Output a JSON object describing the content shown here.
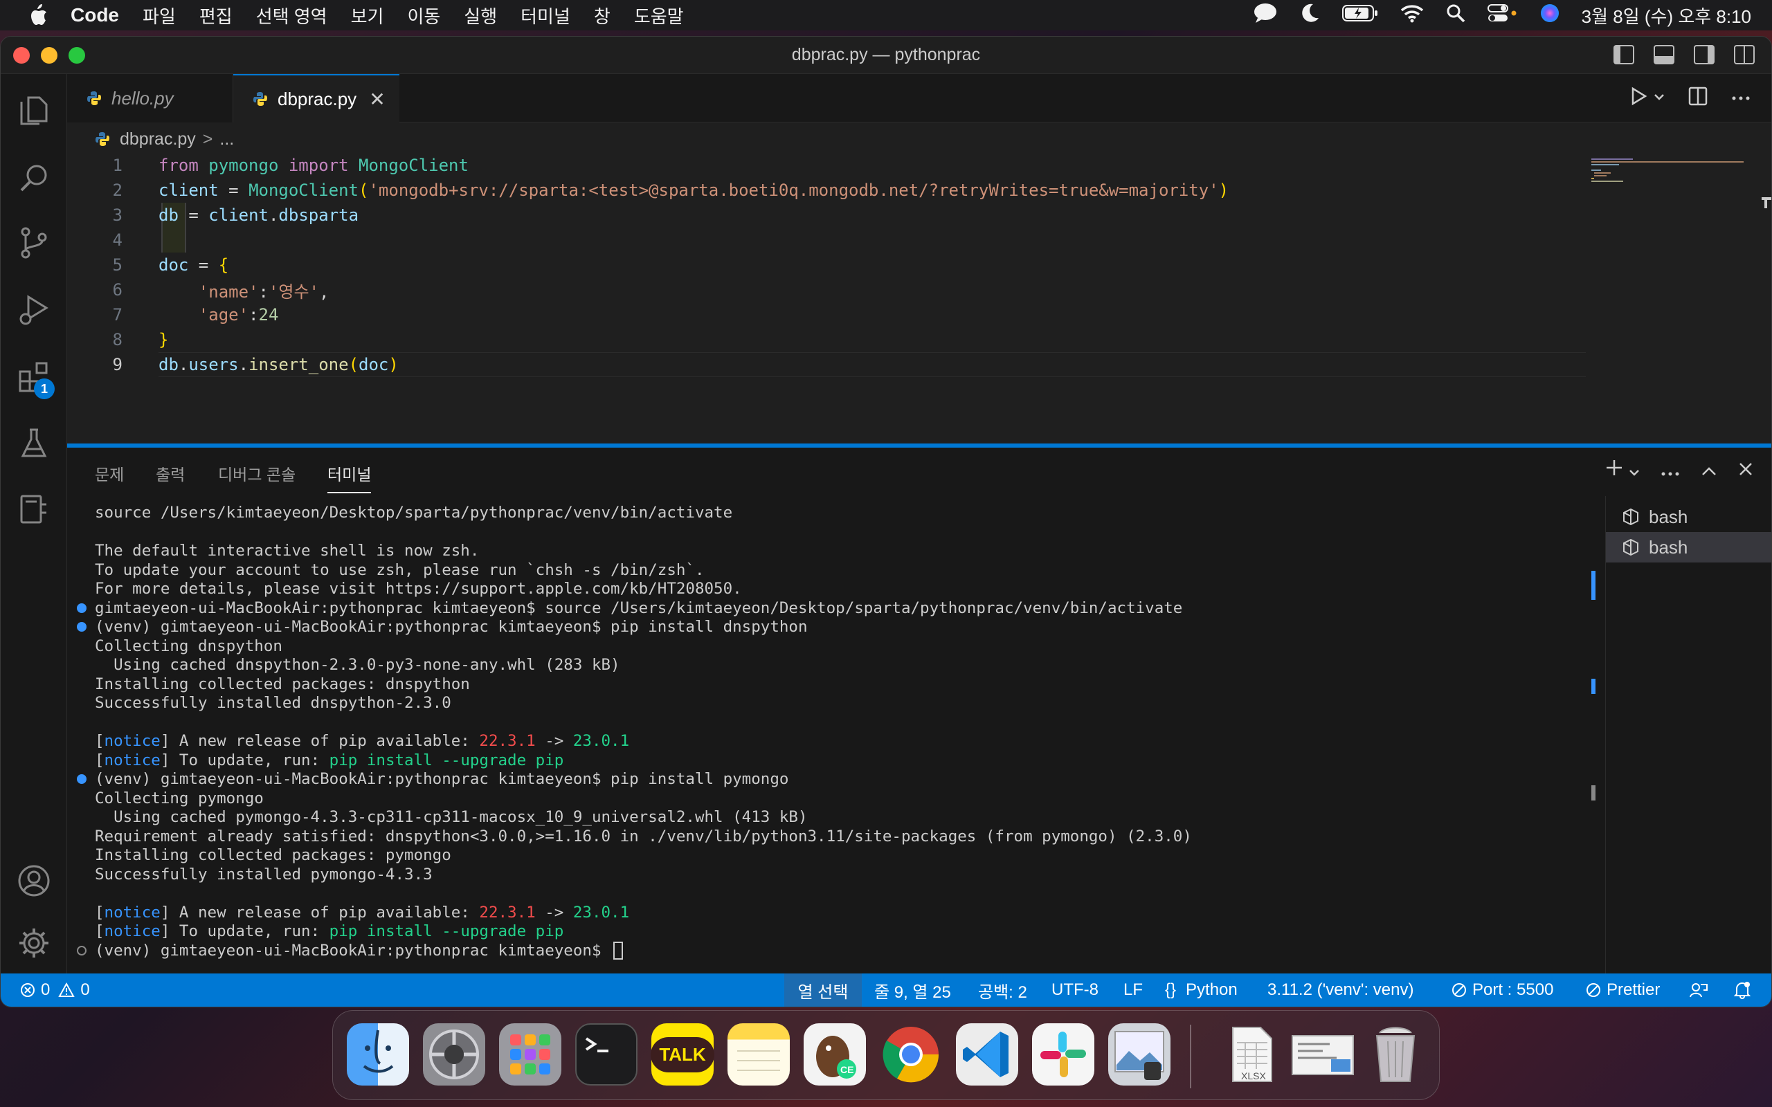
{
  "menubar": {
    "app_name": "Code",
    "items": [
      "파일",
      "편집",
      "선택 영역",
      "보기",
      "이동",
      "실행",
      "터미널",
      "창",
      "도움말"
    ],
    "clock": "3월 8일 (수) 오후 8:10",
    "status_icons": [
      "messages-icon",
      "moon-icon",
      "battery-icon",
      "wifi-icon",
      "spotlight-search-icon",
      "control-center-icon",
      "siri-icon"
    ]
  },
  "window": {
    "title": "dbprac.py — pythonprac"
  },
  "tabs": [
    {
      "label": "hello.py",
      "active": false
    },
    {
      "label": "dbprac.py",
      "active": true,
      "close": "✕"
    }
  ],
  "breadcrumb": {
    "file": "dbprac.py",
    "separator": ">",
    "more": "..."
  },
  "editor": {
    "lines": [
      {
        "n": "1",
        "tokens": [
          [
            "kw",
            "from "
          ],
          [
            "mod",
            "pymongo "
          ],
          [
            "kw",
            "import "
          ],
          [
            "mod",
            "MongoClient"
          ]
        ]
      },
      {
        "n": "2",
        "tokens": [
          [
            "var",
            "client "
          ],
          [
            "op",
            "= "
          ],
          [
            "mod",
            "MongoClient"
          ],
          [
            "brace1",
            "("
          ],
          [
            "str",
            "'mongodb+srv://sparta:<test>@sparta.boeti0q.mongodb.net/?retryWrites=true&w=majority'"
          ],
          [
            "brace1",
            ")"
          ]
        ]
      },
      {
        "n": "3",
        "tokens": [
          [
            "var",
            "db "
          ],
          [
            "op",
            "= "
          ],
          [
            "var",
            "client"
          ],
          [
            "op",
            "."
          ],
          [
            "var",
            "dbsparta"
          ]
        ]
      },
      {
        "n": "4",
        "tokens": []
      },
      {
        "n": "5",
        "tokens": [
          [
            "var",
            "doc "
          ],
          [
            "op",
            "= "
          ],
          [
            "brace1",
            "{"
          ]
        ]
      },
      {
        "n": "6",
        "tokens": [
          [
            "op",
            "    "
          ],
          [
            "str",
            "'name'"
          ],
          [
            "op",
            ":"
          ],
          [
            "str",
            "'영수'"
          ],
          [
            "op",
            ","
          ]
        ]
      },
      {
        "n": "7",
        "tokens": [
          [
            "op",
            "    "
          ],
          [
            "str",
            "'age'"
          ],
          [
            "op",
            ":"
          ],
          [
            "num",
            "24"
          ]
        ]
      },
      {
        "n": "8",
        "tokens": [
          [
            "brace1",
            "}"
          ]
        ]
      },
      {
        "n": "9",
        "tokens": [
          [
            "var",
            "db"
          ],
          [
            "op",
            "."
          ],
          [
            "var",
            "users"
          ],
          [
            "op",
            "."
          ],
          [
            "fn",
            "insert_one"
          ],
          [
            "brace1",
            "("
          ],
          [
            "var",
            "doc"
          ],
          [
            "brace1",
            ")"
          ]
        ]
      }
    ],
    "current_line": "9"
  },
  "panel": {
    "tabs": [
      "문제",
      "출력",
      "디버그 콘솔",
      "터미널"
    ],
    "active_tab": "터미널",
    "terminals": [
      "bash",
      "bash"
    ]
  },
  "terminal": {
    "lines": [
      {
        "dot": "",
        "segs": [
          [
            "",
            "source /Users/kimtaeyeon/Desktop/sparta/pythonprac/venv/bin/activate"
          ]
        ]
      },
      {
        "dot": "",
        "segs": [
          [
            "",
            ""
          ]
        ]
      },
      {
        "dot": "",
        "segs": [
          [
            "",
            "The default interactive shell is now zsh."
          ]
        ]
      },
      {
        "dot": "",
        "segs": [
          [
            "",
            "To update your account to use zsh, please run `chsh -s /bin/zsh`."
          ]
        ]
      },
      {
        "dot": "",
        "segs": [
          [
            "",
            "For more details, please visit https://support.apple.com/kb/HT208050."
          ]
        ]
      },
      {
        "dot": "filled",
        "segs": [
          [
            "",
            "gimtaeyeon-ui-MacBookAir:pythonprac kimtaeyeon$ source /Users/kimtaeyeon/Desktop/sparta/pythonprac/venv/bin/activate"
          ]
        ]
      },
      {
        "dot": "filled",
        "segs": [
          [
            "",
            "(venv) gimtaeyeon-ui-MacBookAir:pythonprac kimtaeyeon$ pip install dnspython"
          ]
        ]
      },
      {
        "dot": "",
        "segs": [
          [
            "",
            "Collecting dnspython"
          ]
        ]
      },
      {
        "dot": "",
        "segs": [
          [
            "",
            "  Using cached dnspython-2.3.0-py3-none-any.whl (283 kB)"
          ]
        ]
      },
      {
        "dot": "",
        "segs": [
          [
            "",
            "Installing collected packages: dnspython"
          ]
        ]
      },
      {
        "dot": "",
        "segs": [
          [
            "",
            "Successfully installed dnspython-2.3.0"
          ]
        ]
      },
      {
        "dot": "",
        "segs": [
          [
            "",
            ""
          ]
        ]
      },
      {
        "dot": "",
        "segs": [
          [
            "",
            "["
          ],
          [
            "notice",
            "notice"
          ],
          [
            "",
            "] A new release of pip available: "
          ],
          [
            "red",
            "22.3.1"
          ],
          [
            "",
            " -> "
          ],
          [
            "green",
            "23.0.1"
          ]
        ]
      },
      {
        "dot": "",
        "segs": [
          [
            "",
            "["
          ],
          [
            "notice",
            "notice"
          ],
          [
            "",
            "] To update, run: "
          ],
          [
            "green",
            "pip install --upgrade pip"
          ]
        ]
      },
      {
        "dot": "filled",
        "segs": [
          [
            "",
            "(venv) gimtaeyeon-ui-MacBookAir:pythonprac kimtaeyeon$ pip install pymongo"
          ]
        ]
      },
      {
        "dot": "",
        "segs": [
          [
            "",
            "Collecting pymongo"
          ]
        ]
      },
      {
        "dot": "",
        "segs": [
          [
            "",
            "  Using cached pymongo-4.3.3-cp311-cp311-macosx_10_9_universal2.whl (413 kB)"
          ]
        ]
      },
      {
        "dot": "",
        "segs": [
          [
            "",
            "Requirement already satisfied: dnspython<3.0.0,>=1.16.0 in ./venv/lib/python3.11/site-packages (from pymongo) (2.3.0)"
          ]
        ]
      },
      {
        "dot": "",
        "segs": [
          [
            "",
            "Installing collected packages: pymongo"
          ]
        ]
      },
      {
        "dot": "",
        "segs": [
          [
            "",
            "Successfully installed pymongo-4.3.3"
          ]
        ]
      },
      {
        "dot": "",
        "segs": [
          [
            "",
            ""
          ]
        ]
      },
      {
        "dot": "",
        "segs": [
          [
            "",
            "["
          ],
          [
            "notice",
            "notice"
          ],
          [
            "",
            "] A new release of pip available: "
          ],
          [
            "red",
            "22.3.1"
          ],
          [
            "",
            " -> "
          ],
          [
            "green",
            "23.0.1"
          ]
        ]
      },
      {
        "dot": "",
        "segs": [
          [
            "",
            "["
          ],
          [
            "notice",
            "notice"
          ],
          [
            "",
            "] To update, run: "
          ],
          [
            "green",
            "pip install --upgrade pip"
          ]
        ]
      },
      {
        "dot": "hollow",
        "segs": [
          [
            "",
            "(venv) gimtaeyeon-ui-MacBookAir:pythonprac kimtaeyeon$ "
          ]
        ],
        "cursor": true
      }
    ]
  },
  "statusbar": {
    "errors": "0",
    "warnings": "0",
    "selection_mode": "열 선택",
    "position": "줄 9, 열 25",
    "spaces": "공백: 2",
    "encoding": "UTF-8",
    "eol": "LF",
    "language": "Python",
    "interpreter": "3.11.2 ('venv': venv)",
    "port": "Port : 5500",
    "formatter": "Prettier"
  },
  "dock": {
    "apps": [
      "finder-icon",
      "system-settings-icon",
      "launchpad-icon",
      "terminal-icon",
      "kakaotalk-icon",
      "notes-icon",
      "pycharm-ce-icon",
      "chrome-icon",
      "vscode-icon",
      "slack-icon",
      "preview-icon",
      "xlsx-document-icon",
      "screenshot-document-icon",
      "trash-icon"
    ],
    "kakaotalk_label": "TALK",
    "xlsx_label": "XLSX"
  },
  "colors": {
    "accent": "#0078d4",
    "editor_bg": "#1f1f1f",
    "panel_bg": "#181818"
  }
}
